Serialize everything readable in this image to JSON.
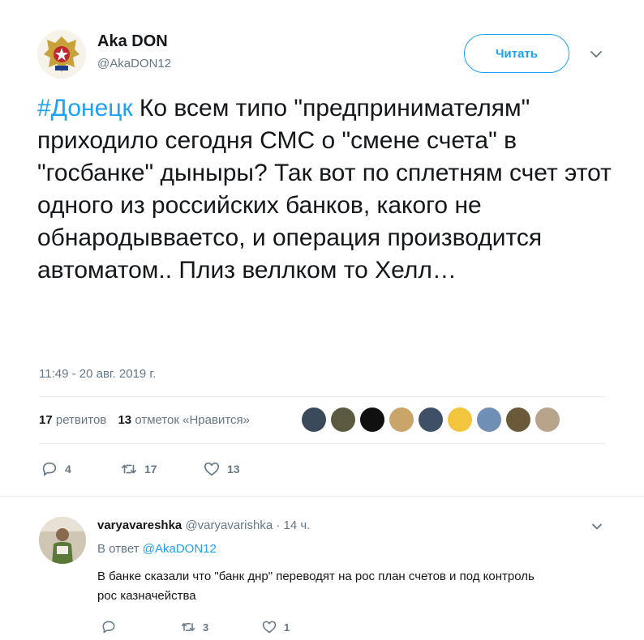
{
  "tweet": {
    "author_name": "Aka DON",
    "author_handle": "@AkaDON12",
    "follow_label": "Читать",
    "hashtag": "#Донецк",
    "text": " Ко всем типо \"предпринимателям\" приходило сегодня СМС о \"смене счета\" в \"госбанке\" дыныры? Так вот по сплетням счет этот одного из российских банков, какого не обнародывваетсо, и операция производится автоматом.. Плиз веллком то Хелл…",
    "timestamp": "11:49 - 20 авг. 2019 г.",
    "retweets_count": "17",
    "retweets_label": "ретвитов",
    "likes_count": "13",
    "likes_label": "отметок «Нравится»",
    "actions": {
      "replies": "4",
      "retweets": "17",
      "likes": "13"
    }
  },
  "likers": [
    {
      "icon": "liker-avatar-1",
      "color": "#3a4a5a"
    },
    {
      "icon": "liker-avatar-2",
      "color": "#5b5a3e"
    },
    {
      "icon": "liker-avatar-3",
      "color": "#101010"
    },
    {
      "icon": "liker-avatar-4",
      "color": "#c9a56a"
    },
    {
      "icon": "liker-avatar-5",
      "color": "#3e4f66"
    },
    {
      "icon": "liker-avatar-6",
      "color": "#f2c53d"
    },
    {
      "icon": "liker-avatar-7",
      "color": "#6f8fb5"
    },
    {
      "icon": "liker-avatar-8",
      "color": "#6b5a3a"
    },
    {
      "icon": "liker-avatar-9",
      "color": "#b7a48a"
    }
  ],
  "reply": {
    "author_name": "varyavareshka",
    "author_handle": "@varyavarishka",
    "time": "· 14 ч.",
    "in_reply_prefix": "В ответ",
    "in_reply_handle": "@AkaDON12",
    "text": "В банке сказали что \"банк днр\" переводят на рос план счетов и под контроль рос казначейства",
    "actions": {
      "retweets": "3",
      "likes": "1"
    }
  },
  "colors": {
    "accent": "#1da1f2",
    "muted": "#657786",
    "text": "#14171a",
    "divider": "#e6ecf0"
  }
}
